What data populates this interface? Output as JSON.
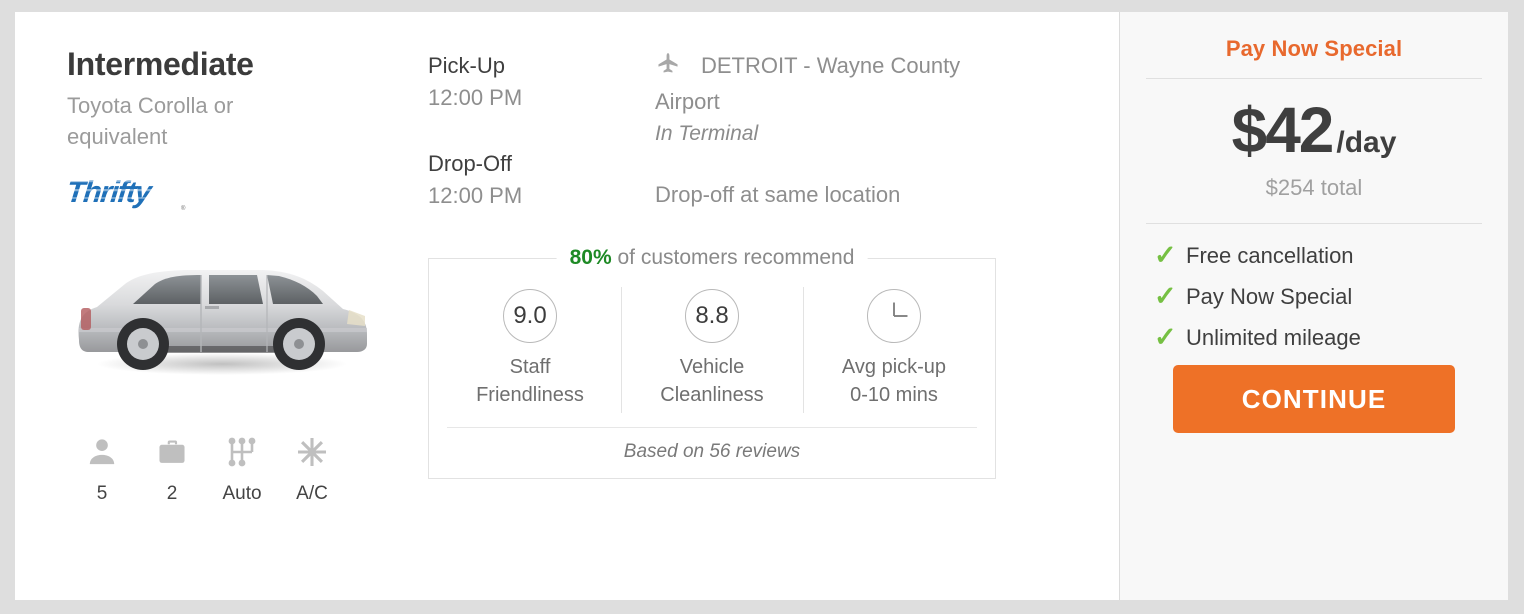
{
  "vehicle": {
    "category": "Intermediate",
    "model": "Toyota Corolla or equivalent",
    "supplier_name": "Thrifty",
    "supplier_logo_text": "Thrifty",
    "supplier_logo_color": "#1f70b8",
    "car_photo_alt": "silver sedan side view",
    "specs": [
      {
        "icon": "person-icon",
        "label": "5",
        "meaning": "passengers"
      },
      {
        "icon": "suitcase-icon",
        "label": "2",
        "meaning": "bags"
      },
      {
        "icon": "transmission-icon",
        "label": "Auto",
        "meaning": "transmission"
      },
      {
        "icon": "snowflake-icon",
        "label": "A/C",
        "meaning": "air conditioning"
      }
    ]
  },
  "itinerary": {
    "pickup": {
      "label": "Pick-Up",
      "time": "12:00 PM",
      "location_icon": "airplane-icon",
      "location": "DETROIT - Wayne County Airport",
      "location_note": "In Terminal"
    },
    "dropoff": {
      "label": "Drop-Off",
      "time": "12:00 PM",
      "location": "Drop-off at same location"
    }
  },
  "reviews": {
    "recommend_percent": "80%",
    "recommend_text": "of customers recommend",
    "ratings": [
      {
        "value": "9.0",
        "caption": "Staff\nFriendliness",
        "icon": ""
      },
      {
        "value": "8.8",
        "caption": "Vehicle\nCleanliness",
        "icon": ""
      },
      {
        "value": "",
        "caption": "Avg pick-up\n0-10 mins",
        "icon": "clock-icon"
      }
    ],
    "rating_1_value": "9.0",
    "rating_1_line1": "Staff",
    "rating_1_line2": "Friendliness",
    "rating_2_value": "8.8",
    "rating_2_line1": "Vehicle",
    "rating_2_line2": "Cleanliness",
    "rating_3_line1": "Avg pick-up",
    "rating_3_line2": "0-10 mins",
    "footer": "Based on 56 reviews",
    "highlight_color": "#1e8a25"
  },
  "price_panel": {
    "promo_title": "Pay Now Special",
    "promo_color": "#e8692e",
    "amount": "$42",
    "unit": "/day",
    "total": "$254 total",
    "benefits": [
      {
        "check": "✓",
        "label": "Free cancellation"
      },
      {
        "check": "✓",
        "label": "Pay Now Special"
      },
      {
        "check": "✓",
        "label": "Unlimited mileage"
      }
    ],
    "benefit_1": "Free cancellation",
    "benefit_2": "Pay Now Special",
    "benefit_3": "Unlimited mileage",
    "check_glyph": "✓",
    "check_color": "#76c043",
    "continue_label": "CONTINUE",
    "continue_color": "#ee7127"
  }
}
